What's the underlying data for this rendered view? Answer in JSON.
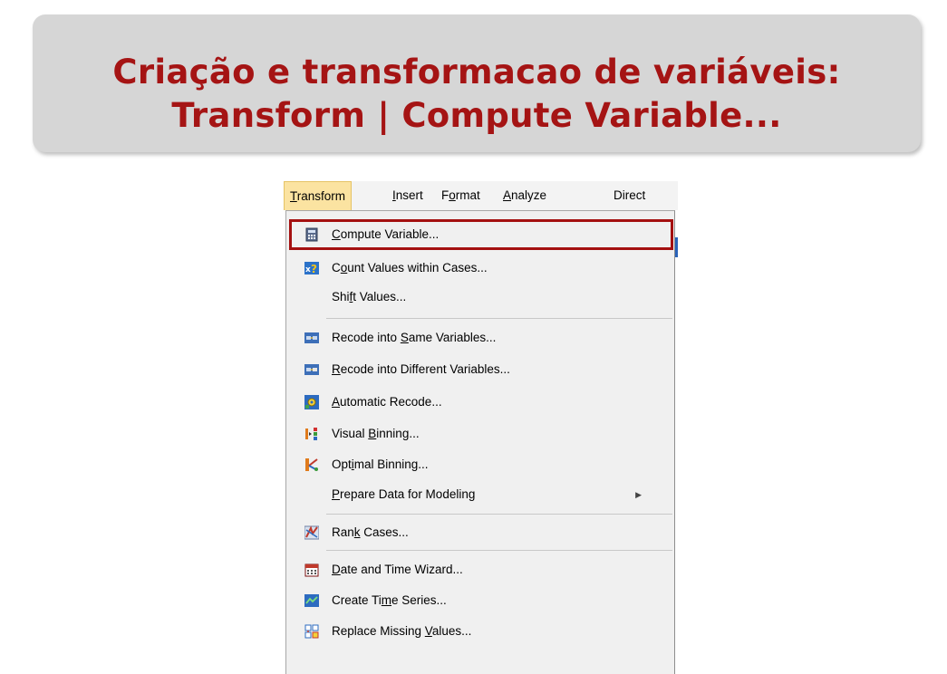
{
  "slide": {
    "title_line1": "Criação e transformacao de variáveis:",
    "title_line2": "Transform | Compute Variable..."
  },
  "menubar": {
    "items": [
      {
        "pre": "",
        "u": "T",
        "post": "ransform"
      },
      {
        "pre": "",
        "u": "I",
        "post": "nsert"
      },
      {
        "pre": "F",
        "u": "o",
        "post": "rmat"
      },
      {
        "pre": "",
        "u": "A",
        "post": "nalyze"
      },
      {
        "pre": "Direct ",
        "u": "M",
        "post": "arketing"
      }
    ]
  },
  "menu": {
    "items": [
      {
        "pre": "",
        "u": "C",
        "post": "ompute Variable...",
        "icon": "calculator-icon"
      },
      {
        "pre": "C",
        "u": "o",
        "post": "unt Values within Cases...",
        "icon": "count-values-icon"
      },
      {
        "pre": "Shi",
        "u": "f",
        "post": "t Values...",
        "icon": ""
      },
      {
        "pre": "Recode into ",
        "u": "S",
        "post": "ame Variables...",
        "icon": "recode-same-icon"
      },
      {
        "pre": "",
        "u": "R",
        "post": "ecode into Different Variables...",
        "icon": "recode-different-icon"
      },
      {
        "pre": "",
        "u": "A",
        "post": "utomatic Recode...",
        "icon": "automatic-recode-icon"
      },
      {
        "pre": "Visual ",
        "u": "B",
        "post": "inning...",
        "icon": "visual-binning-icon"
      },
      {
        "pre": "Opt",
        "u": "i",
        "post": "mal Binning...",
        "icon": "optimal-binning-icon"
      },
      {
        "pre": "",
        "u": "P",
        "post": "repare Data for Modeling",
        "icon": ""
      },
      {
        "pre": "Ran",
        "u": "k",
        "post": " Cases...",
        "icon": "rank-cases-icon"
      },
      {
        "pre": "",
        "u": "D",
        "post": "ate and Time Wizard...",
        "icon": "calendar-icon"
      },
      {
        "pre": "Create Ti",
        "u": "m",
        "post": "e Series...",
        "icon": "time-series-icon"
      },
      {
        "pre": "Replace Missing ",
        "u": "V",
        "post": "alues...",
        "icon": "replace-missing-icon"
      }
    ]
  }
}
